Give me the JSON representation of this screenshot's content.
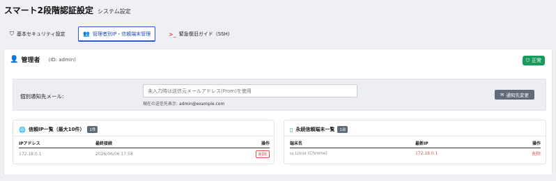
{
  "header": {
    "title": "スマート2段階認証設定",
    "subtitle": "システム設定"
  },
  "tabs": [
    {
      "label": "基本セキュリティ設定",
      "icon": "shield-icon"
    },
    {
      "label": "管理者別IP・信頼端末管理",
      "icon": "users-icon"
    },
    {
      "label": "緊急復旧ガイド（SSH）",
      "icon": "terminal-icon"
    }
  ],
  "admin": {
    "title": "管理者",
    "id_text": "(ID: admin)"
  },
  "status": {
    "label": "正常",
    "color": "#1a9b5b"
  },
  "notify": {
    "label": "個別通知先メール:",
    "placeholder": "未入力時は送信元メールアドレス(From)を使用",
    "hint_prefix": "現在の送信先表示:",
    "hint_email": "admin@example.com",
    "button_label": "通知先変更"
  },
  "ip_card": {
    "title": "信頼IP一覧（最大10件）",
    "count": "1件",
    "columns": [
      "IPアドレス",
      "最終接続",
      "操作"
    ],
    "rows": [
      {
        "ip": "172.18.0.1",
        "last": "2026/06/06 17:58",
        "action": "削除"
      }
    ]
  },
  "device_card": {
    "title": "永続信頼端末一覧",
    "count": "1台",
    "columns": [
      "端末名",
      "最新IP",
      "操作"
    ],
    "rows": [
      {
        "name": "Linux (Chrome)",
        "ip": "172.18.0.1",
        "action": "削除"
      }
    ]
  }
}
